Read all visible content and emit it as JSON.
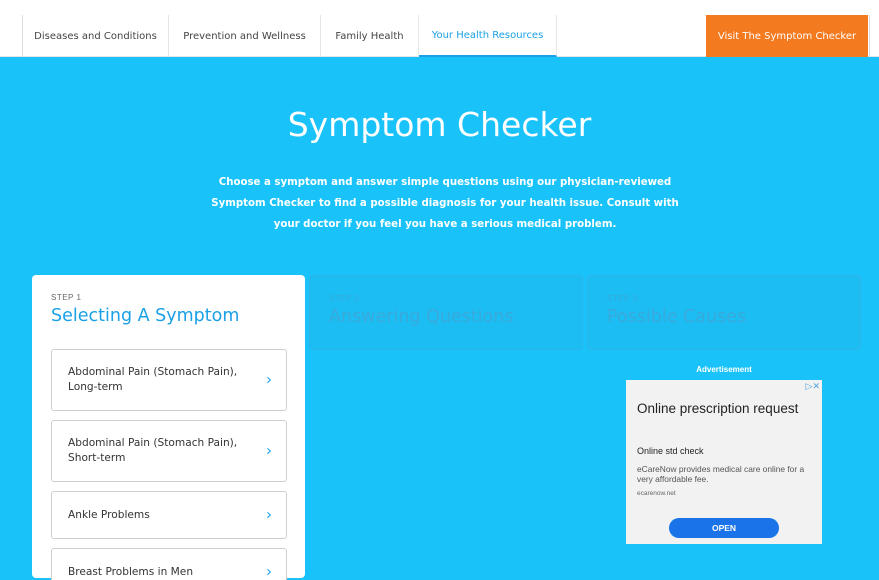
{
  "nav": {
    "items": [
      {
        "label": "Diseases and Conditions",
        "active": false
      },
      {
        "label": "Prevention and Wellness",
        "active": false
      },
      {
        "label": "Family Health",
        "active": false
      },
      {
        "label": "Your Health Resources",
        "active": true
      }
    ],
    "cta_label": "Visit The Symptom Checker"
  },
  "hero": {
    "title": "Symptom Checker",
    "description": "Choose a symptom and answer simple questions using our physician-reviewed Symptom Checker to find a possible diagnosis for your health issue. Consult with your doctor if you feel you have a serious medical problem."
  },
  "steps": [
    {
      "number": "STEP 1",
      "name": "Selecting A Symptom",
      "active": true
    },
    {
      "number": "STEP 2",
      "name": "Answering Questions",
      "active": false
    },
    {
      "number": "STEP 3",
      "name": "Possible Causes",
      "active": false
    }
  ],
  "symptoms": [
    {
      "label": "Abdominal Pain (Stomach Pain), Long-term"
    },
    {
      "label": "Abdominal Pain (Stomach Pain), Short-term"
    },
    {
      "label": "Ankle Problems"
    },
    {
      "label": "Breast Problems in Men"
    }
  ],
  "ad": {
    "label": "Advertisement",
    "adchoices": "▷✕",
    "title": "Online prescription request",
    "subtitle": "Online std check",
    "body": "eCareNow provides medical care online for a very affordable fee.",
    "url": "ecarenow.net",
    "button": "OPEN"
  },
  "colors": {
    "hero_bg": "#19c3fa",
    "accent_blue": "#1aa0e6",
    "cta_orange": "#f47a20",
    "ad_button": "#1a73e8"
  },
  "icons": {
    "chevron": "chevron-right-icon"
  }
}
